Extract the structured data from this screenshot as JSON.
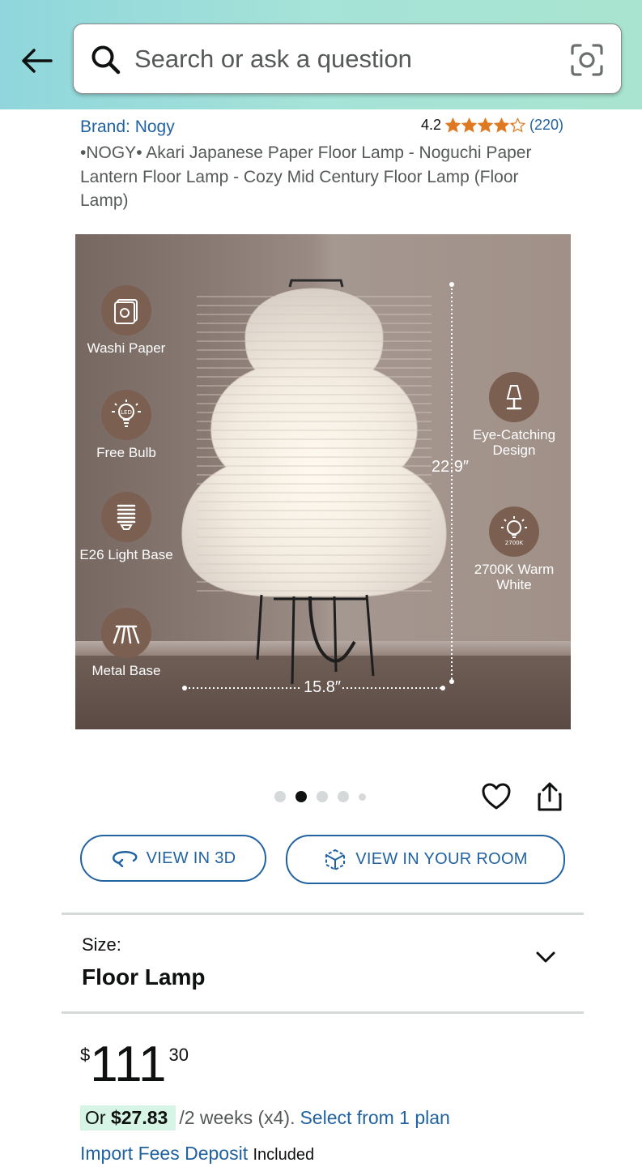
{
  "header": {
    "search_placeholder": "Search or ask a question"
  },
  "product": {
    "brand": "Brand: Nogy",
    "rating_value": "4.2",
    "rating_stars": 4.2,
    "rating_count": "(220)",
    "title": "•NOGY• Akari Japanese Paper Floor Lamp - Noguchi Paper Lantern Floor Lamp - Cozy Mid Century Floor Lamp (Floor Lamp)"
  },
  "image": {
    "features_left": [
      {
        "label": "Washi Paper",
        "icon": "washi-paper-icon"
      },
      {
        "label": "Free Bulb",
        "icon": "led-bulb-icon"
      },
      {
        "label": "E26 Light Base",
        "icon": "e26-base-icon"
      },
      {
        "label": "Metal Base",
        "icon": "metal-base-icon"
      }
    ],
    "features_right": [
      {
        "label": "Eye-Catching Design",
        "icon": "table-lamp-icon"
      },
      {
        "label": "2700K Warm White",
        "icon": "warm-bulb-icon",
        "badge": "2700K"
      }
    ],
    "height_dim": "22.9″",
    "width_dim": "15.8″",
    "carousel_total": 5,
    "carousel_active": 2
  },
  "actions": {
    "view_3d": "VIEW IN 3D",
    "view_room": "VIEW IN YOUR ROOM"
  },
  "size": {
    "label": "Size:",
    "value": "Floor Lamp"
  },
  "price": {
    "symbol": "$",
    "whole": "111",
    "fraction": "30"
  },
  "installments": {
    "prefix": "Or ",
    "amount": "$27.83",
    "terms": "/2 weeks (x4).",
    "link": "Select from 1 plan"
  },
  "import": {
    "link": "Import Fees Deposit",
    "status": "Included"
  },
  "colors": {
    "link": "#2162a1",
    "star": "#de7921",
    "highlight": "#d7f5e6",
    "header_start": "#8fd6dc",
    "header_end": "#a8e4cf"
  }
}
